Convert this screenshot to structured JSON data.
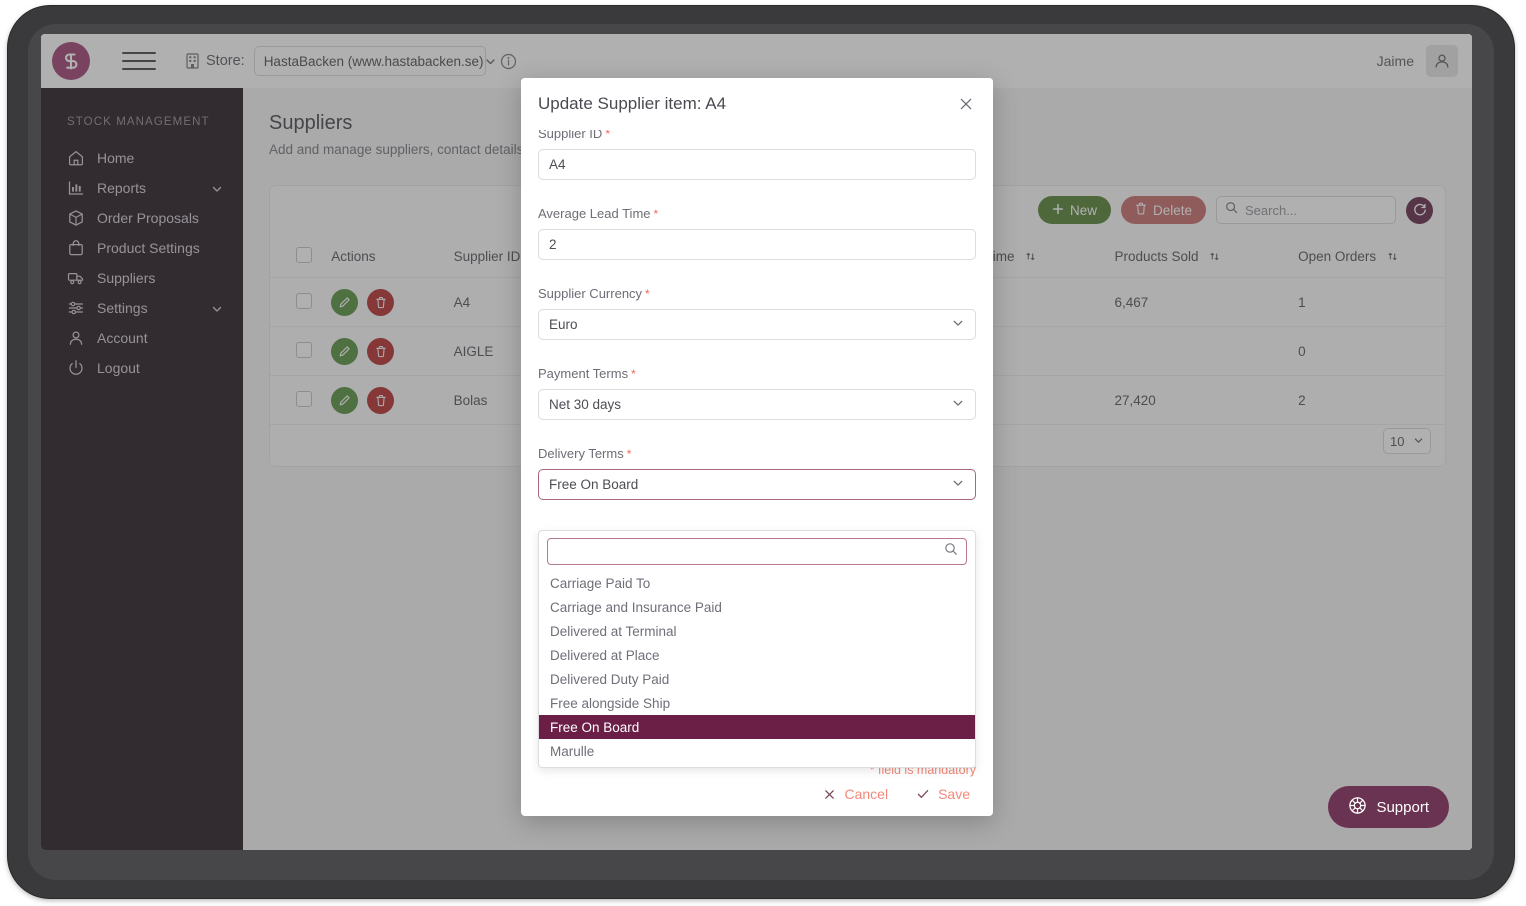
{
  "topbar": {
    "store_label": "Store:",
    "store_value": "HastaBacken (www.hastabacken.se)",
    "user_name": "Jaime"
  },
  "sidebar": {
    "title": "STOCK MANAGEMENT",
    "items": [
      {
        "label": "Home",
        "icon": "home-icon",
        "expandable": false
      },
      {
        "label": "Reports",
        "icon": "chart-bar-icon",
        "expandable": true
      },
      {
        "label": "Order Proposals",
        "icon": "box-icon",
        "expandable": false
      },
      {
        "label": "Product Settings",
        "icon": "bag-icon",
        "expandable": false
      },
      {
        "label": "Suppliers",
        "icon": "truck-icon",
        "expandable": false
      },
      {
        "label": "Settings",
        "icon": "sliders-icon",
        "expandable": true
      },
      {
        "label": "Account",
        "icon": "user-icon",
        "expandable": false
      },
      {
        "label": "Logout",
        "icon": "power-icon",
        "expandable": false
      }
    ]
  },
  "page": {
    "title": "Suppliers",
    "subtitle": "Add and manage suppliers, contact details, l"
  },
  "toolbar": {
    "new_label": "New",
    "delete_label": "Delete",
    "search_placeholder": "Search...",
    "search_value": ""
  },
  "table": {
    "columns": [
      "",
      "Actions",
      "Supplier ID",
      "",
      "",
      "verage Lead Time",
      "Products Sold",
      "Open Orders"
    ],
    "headers": {
      "actions": "Actions",
      "supplier_id": "Supplier ID",
      "avg_lead_time": "verage Lead Time",
      "products_sold": "Products Sold",
      "open_orders": "Open Orders"
    },
    "rows": [
      {
        "supplier_id": "A4",
        "products_sold": "6,467",
        "open_orders": "1"
      },
      {
        "supplier_id": "AIGLE",
        "products_sold": "",
        "open_orders": "0"
      },
      {
        "supplier_id": "Bolas",
        "products_sold": "27,420",
        "open_orders": "2"
      }
    ]
  },
  "pager": {
    "page_size": "10"
  },
  "support": {
    "label": "Support"
  },
  "modal": {
    "title": "Update Supplier item: A4",
    "fields": [
      {
        "label": "Supplier ID",
        "value": "A4",
        "type": "text"
      },
      {
        "label": "Average Lead Time",
        "value": "2",
        "type": "text"
      },
      {
        "label": "Supplier Currency",
        "value": "Euro",
        "type": "select"
      },
      {
        "label": "Payment Terms",
        "value": "Net 30 days",
        "type": "select"
      },
      {
        "label": "Delivery Terms",
        "value": "Free On Board",
        "type": "select"
      }
    ],
    "dropdown": {
      "search_value": "",
      "options": [
        "Carriage Paid To",
        "Carriage and Insurance Paid",
        "Delivered at Terminal",
        "Delivered at Place",
        "Delivered Duty Paid",
        "Free alongside Ship",
        "Free On Board",
        "Marulle"
      ],
      "selected": "Free On Board"
    },
    "mandatory_note": "* field is mandatory",
    "cancel_label": "Cancel",
    "save_label": "Save"
  },
  "colors": {
    "brand": "#9c3a6e",
    "sidebar_bg": "#1b0f18",
    "highlight": "#6b1f47",
    "new_green": "#4d7c2a",
    "delete_red": "#c56565",
    "required_red": "#f06a5a",
    "support_plum": "#6b3352"
  }
}
